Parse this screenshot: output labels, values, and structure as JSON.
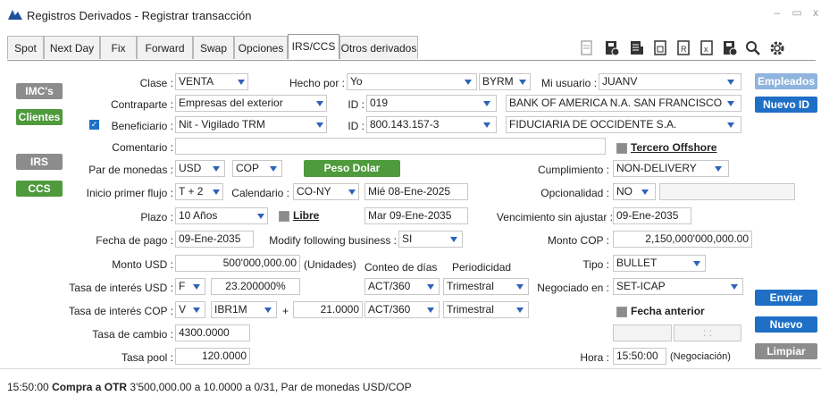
{
  "window": {
    "title": "Registros Derivados - Registrar transacción",
    "min": "–",
    "max": "▭",
    "close": "x"
  },
  "tabs": [
    {
      "label": "Spot"
    },
    {
      "label": "Next Day"
    },
    {
      "label": "Fix"
    },
    {
      "label": "Forward"
    },
    {
      "label": "Swap"
    },
    {
      "label": "Opciones"
    },
    {
      "label": "IRS/CCS"
    },
    {
      "label": "Otros derivados"
    }
  ],
  "toolbar_icons": [
    "document-icon",
    "save-icon",
    "list-icon",
    "report-icon",
    "r-icon",
    "excel-icon",
    "save-alt-icon",
    "search-icon",
    "gear-icon"
  ],
  "left_buttons": {
    "imcs": "IMC's",
    "clientes": "Clientes",
    "irs": "IRS",
    "ccs": "CCS"
  },
  "right_buttons": {
    "empleados": "Empleados",
    "nuevo_id": "Nuevo ID",
    "enviar": "Enviar",
    "nuevo": "Nuevo",
    "limpiar": "Limpiar"
  },
  "form": {
    "clase_label": "Clase :",
    "clase": "VENTA",
    "hecho_por_label": "Hecho por :",
    "hecho_por": "Yo",
    "hecho_por_code": "BYRM",
    "mi_usuario_label": "Mi usuario :",
    "mi_usuario": "JUANV",
    "contraparte_label": "Contraparte :",
    "contraparte": "Empresas del exterior",
    "id1_label": "ID :",
    "id1": "019",
    "contraparte_name": "BANK OF AMERICA N.A. SAN FRANCISCO",
    "beneficiario_label": "Beneficiario :",
    "beneficiario": "Nit - Vigilado TRM",
    "id2_label": "ID :",
    "id2": "800.143.157-3",
    "beneficiario_name": "FIDUCIARIA DE OCCIDENTE S.A.",
    "comentario_label": "Comentario :",
    "comentario": "",
    "tercero_offshore": "Tercero Offshore",
    "par_label": "Par de monedas :",
    "par1": "USD",
    "par2": "COP",
    "peso_dolar": "Peso Dolar",
    "cumplimiento_label": "Cumplimiento :",
    "cumplimiento": "NON-DELIVERY",
    "inicio_label": "Inicio primer flujo :",
    "inicio": "T + 2",
    "calendario_label": "Calendario :",
    "calendario": "CO-NY",
    "inicio_fecha": "Mié 08-Ene-2025",
    "opcionalidad_label": "Opcionalidad :",
    "opcionalidad": "NO",
    "opcionalidad_extra": "",
    "plazo_label": "Plazo :",
    "plazo": "10 Años",
    "libre": "Libre",
    "plazo_fecha": "Mar 09-Ene-2035",
    "vencimiento_label": "Vencimiento sin ajustar :",
    "vencimiento": "09-Ene-2035",
    "fecha_pago_label": "Fecha de pago :",
    "fecha_pago": "09-Ene-2035",
    "modify_label": "Modify following business :",
    "modify": "SI",
    "monto_cop_label": "Monto COP :",
    "monto_cop": "2,150,000'000,000.00",
    "monto_usd_label": "Monto USD :",
    "monto_usd": "500'000,000.00",
    "unidades": "(Unidades)",
    "conteo_label": "Conteo de días",
    "periodicidad_label": "Periodicidad",
    "tipo_label": "Tipo :",
    "tipo": "BULLET",
    "tasa_usd_label": "Tasa de interés USD :",
    "tasa_usd_tipo": "F",
    "tasa_usd": "23.200000%",
    "conteo_usd": "ACT/360",
    "periodicidad_usd": "Trimestral",
    "negociado_label": "Negociado en :",
    "negociado": "SET-ICAP",
    "tasa_cop_label": "Tasa de interés COP :",
    "tasa_cop_tipo": "V",
    "tasa_cop_indice": "IBR1M",
    "plus": "+",
    "tasa_cop_spread": "21.0000",
    "conteo_cop": "ACT/360",
    "periodicidad_cop": "Trimestral",
    "fecha_anterior": "Fecha anterior",
    "tasa_cambio_label": "Tasa de cambio :",
    "tasa_cambio": "4300.0000",
    "fecha_anterior_date": "",
    "fecha_anterior_time": ": :",
    "tasa_pool_label": "Tasa pool :",
    "tasa_pool": "120.0000",
    "hora_label": "Hora :",
    "hora": "15:50:00",
    "negociacion": "(Negociación)"
  },
  "status": {
    "time": "15:50:00",
    "bold": "Compra a OTR",
    "rest": "3'500,000.00 a 10.0000 a 0/31, Par de monedas USD/COP"
  },
  "colors": {
    "accent_blue": "#1f6fc7",
    "green": "#4e9a3c",
    "gray": "#8c8c8c",
    "dropdown": "#2f63b9"
  }
}
